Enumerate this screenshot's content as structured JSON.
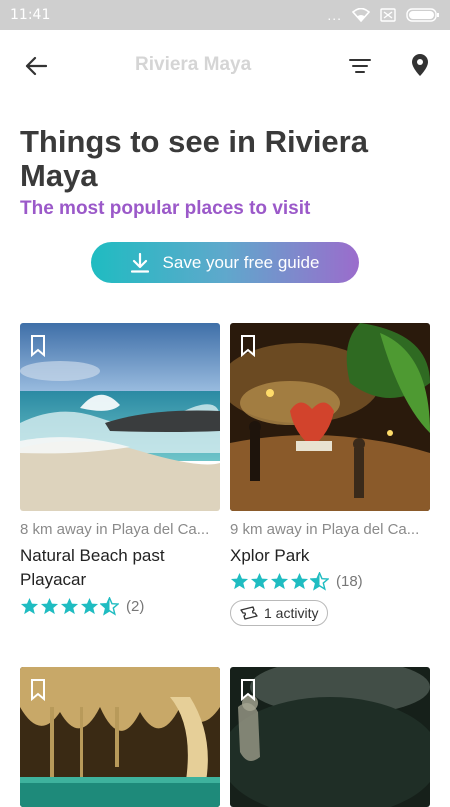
{
  "status_bar": {
    "time": "11:41",
    "dots": "..."
  },
  "header": {
    "title": "Riviera Maya"
  },
  "page": {
    "title": "Things to see in Riviera Maya",
    "subtitle": "The most popular places to visit",
    "save_button": "Save your free guide"
  },
  "colors": {
    "accent_purple": "#9b59c9",
    "accent_teal": "#1fbcc1",
    "star": "#1fbcc1"
  },
  "places": [
    {
      "distance": "8 km away in Playa del Ca...",
      "name": "Natural Beach past Playacar",
      "rating": 4.5,
      "reviews": "(2)"
    },
    {
      "distance": "9 km away in Playa del Ca...",
      "name": "Xplor Park",
      "rating": 4.5,
      "reviews": "(18)",
      "activity": "1 activity"
    },
    {
      "name": ""
    },
    {
      "name": ""
    }
  ]
}
